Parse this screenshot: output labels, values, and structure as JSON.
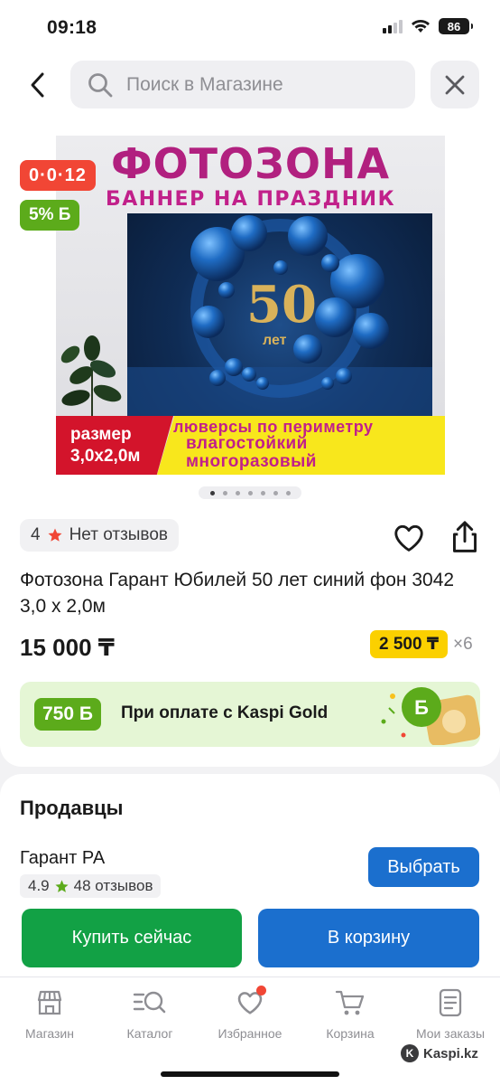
{
  "status_bar": {
    "time": "09:18",
    "battery": "86",
    "icons": [
      "cellular-signal-icon",
      "wifi-icon",
      "battery-icon"
    ]
  },
  "search": {
    "placeholder": "Поиск в Магазине",
    "back_icon": "chevron-left-icon",
    "close_icon": "close-icon"
  },
  "banner": {
    "title": "ФОТОЗОНА",
    "subtitle": "БАННЕР НА ПРАЗДНИК",
    "anniversary_number": "50",
    "anniversary_word": "лет",
    "size_label": "размер",
    "size_value": "3,0х2,0м",
    "feature_1": "люверсы по периметру",
    "feature_2": "влагостойкий",
    "feature_3": "многоразовый"
  },
  "badges": {
    "timer": "0·0·12",
    "bonus": "5% Б"
  },
  "carousel": {
    "total": 7,
    "active": 1
  },
  "rating": {
    "value": "4",
    "reviews": "Нет отзывов"
  },
  "product": {
    "title": "Фотозона Гарант Юбилей 50 лет синий фон 3042 3,0 х 2,0м",
    "price": "15 000 ₸",
    "installment_amount": "2 500 ₸",
    "installment_multiplier": "×6"
  },
  "kaspi_gold": {
    "bonus": "750 Б",
    "text": "При оплате с Kaspi Gold"
  },
  "sellers": {
    "title": "Продавцы",
    "seller_name": "Гарант РА",
    "seller_score": "4.9",
    "seller_reviews": "48 отзывов",
    "choose_label": "Выбрать"
  },
  "actions": {
    "buy_now": "Купить сейчас",
    "to_cart": "В корзину"
  },
  "tabs": [
    {
      "label": "Магазин",
      "icon": "store-icon"
    },
    {
      "label": "Каталог",
      "icon": "catalog-search-icon"
    },
    {
      "label": "Избранное",
      "icon": "heart-icon"
    },
    {
      "label": "Корзина",
      "icon": "cart-icon"
    },
    {
      "label": "Мои заказы",
      "icon": "orders-icon"
    }
  ],
  "watermark": "Kaspi.kz",
  "colors": {
    "accent_blue": "#1b6fce",
    "buy_green": "#12a145",
    "bonus_green": "#5cab1b",
    "timer_red": "#f14635",
    "installment_yellow": "#fbd000"
  }
}
